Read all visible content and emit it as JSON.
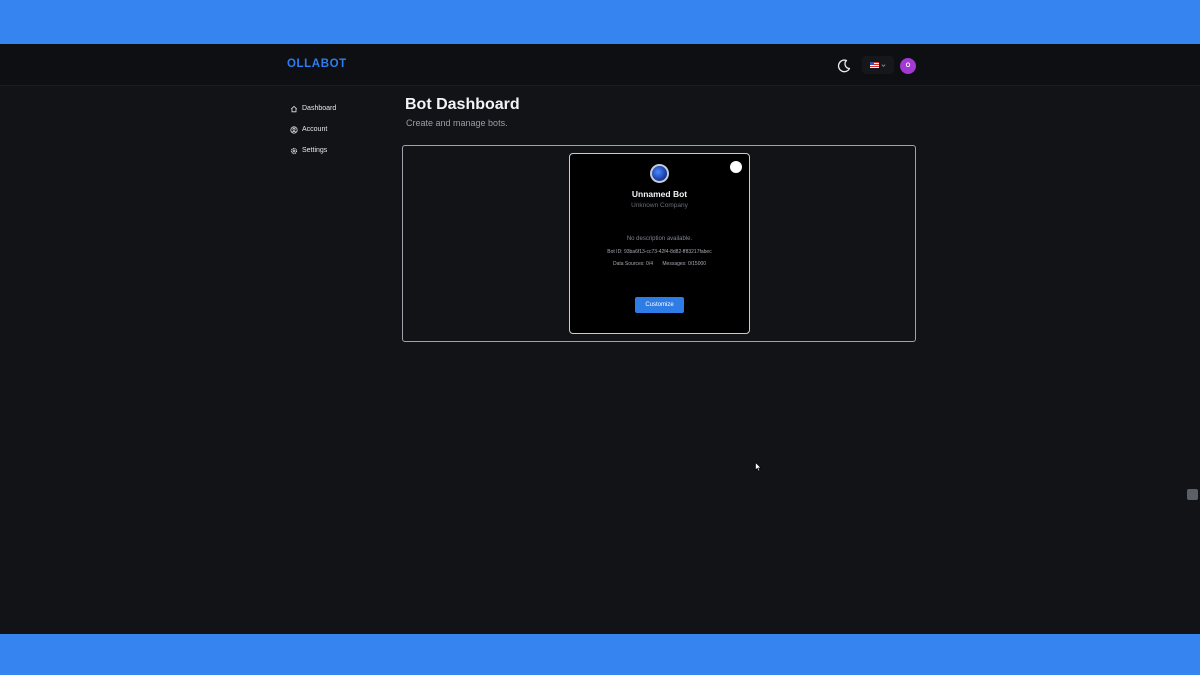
{
  "app": {
    "logo": "OLLABOT"
  },
  "header": {
    "theme_toggle_icon": "moon-icon",
    "language_flag_icon": "us-flag-icon",
    "language_dropdown_icon": "chevron-down-icon",
    "avatar_initial": "O",
    "avatar_color": "#a03ad2"
  },
  "sidebar": {
    "items": [
      {
        "label": "Dashboard",
        "icon": "home-icon"
      },
      {
        "label": "Account",
        "icon": "user-circle-icon"
      },
      {
        "label": "Settings",
        "icon": "gear-icon"
      }
    ]
  },
  "main": {
    "title": "Bot Dashboard",
    "subtitle": "Create and manage bots."
  },
  "bots": [
    {
      "name": "Unnamed Bot",
      "company": "Unknown Company",
      "description": "No description available.",
      "bot_id_text": "Bot ID: 93ba6f13-cc73-42f4-8d82-ff83217fabec",
      "data_sources_text": "Data Sources: 0/4",
      "messages_text": "Messages: 0/15000",
      "customize_label": "Customize"
    }
  ],
  "colors": {
    "brand": "#2f7df0",
    "background": "#111317",
    "frame": "#3584f0",
    "button": "#2e7ce6"
  }
}
